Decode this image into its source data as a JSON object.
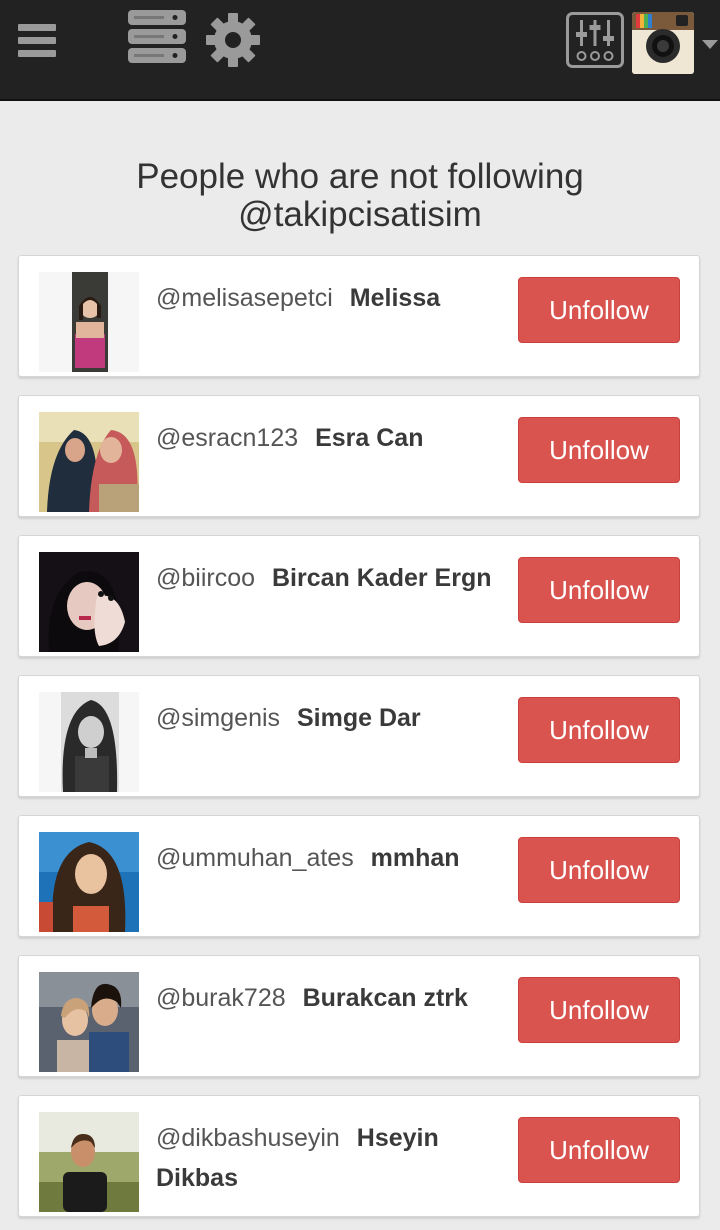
{
  "header": {
    "icons": [
      "menu-icon",
      "server-stack-icon",
      "gear-icon",
      "sliders-icon",
      "instagram-camera-icon",
      "caret-down-icon"
    ]
  },
  "page": {
    "title_line1": "People who are not following",
    "title_line2": "@takipcisatisim"
  },
  "users": [
    {
      "handle": "@melisasepetci",
      "name": "Melissa",
      "button": "Unfollow"
    },
    {
      "handle": "@esracn123",
      "name": "Esra Can",
      "button": "Unfollow"
    },
    {
      "handle": "@biircoo",
      "name": "Bircan Kader Ergn",
      "button": "Unfollow"
    },
    {
      "handle": "@simgenis",
      "name": "Simge Dar",
      "button": "Unfollow"
    },
    {
      "handle": "@ummuhan_ates",
      "name": "mmhan",
      "button": "Unfollow"
    },
    {
      "handle": "@burak728",
      "name": "Burakcan ztrk",
      "button": "Unfollow"
    },
    {
      "handle": "@dikbashuseyin",
      "name": "Hseyin Dikbas",
      "button": "Unfollow"
    }
  ],
  "colors": {
    "topbar": "#222222",
    "background": "#ebebeb",
    "unfollow_button": "#d9534f"
  }
}
